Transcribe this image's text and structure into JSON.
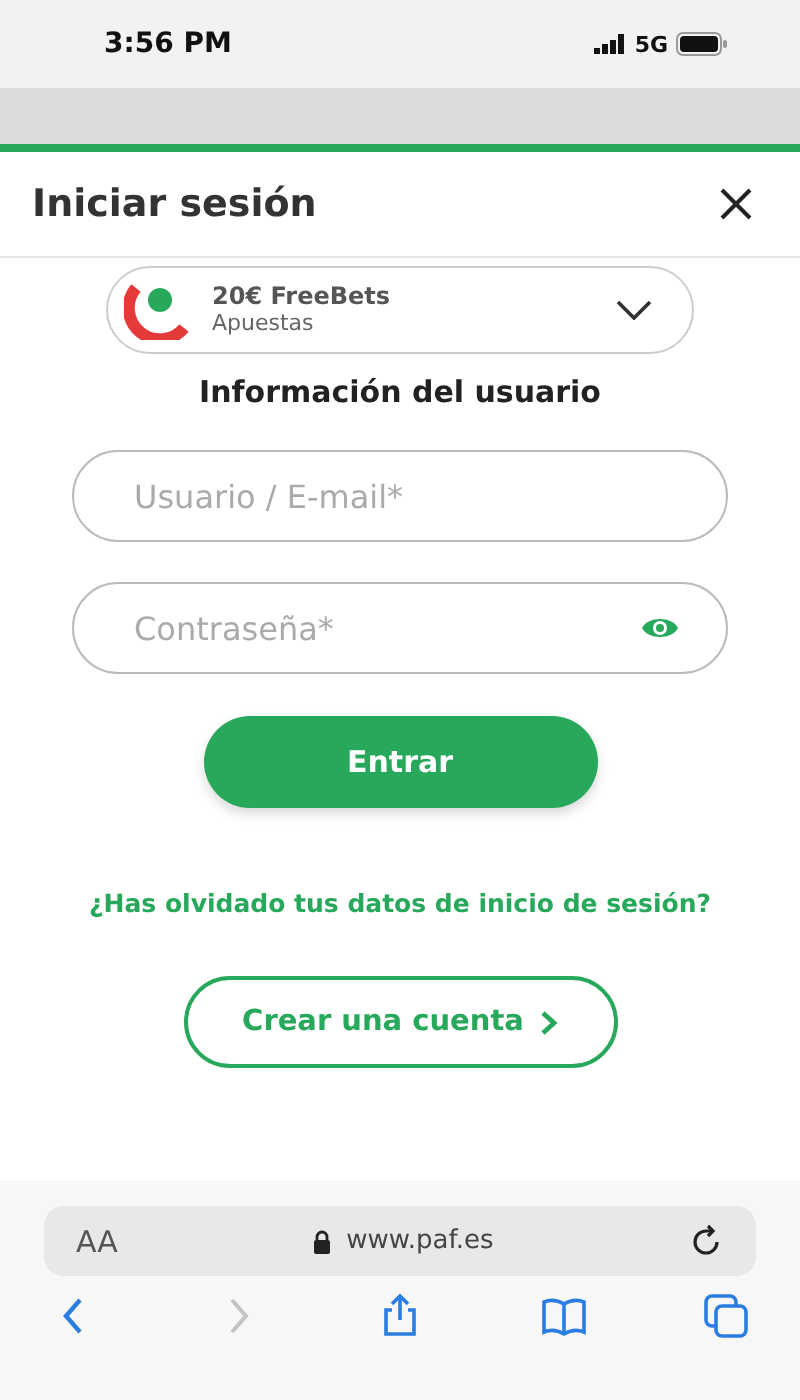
{
  "status_bar": {
    "time": "3:56 PM",
    "network": "5G"
  },
  "header": {
    "title": "Iniciar sesión"
  },
  "promo": {
    "title": "20€ FreeBets",
    "subtitle": "Apuestas"
  },
  "section_title": "Información del usuario",
  "fields": [
    {
      "placeholder": "Usuario / E-mail*",
      "kind": "text"
    },
    {
      "placeholder": "Contraseña*",
      "kind": "password"
    }
  ],
  "submit_button": "Entrar",
  "forgot_link": "¿Has olvidado tus datos de inicio de sesión?",
  "create_account_button": "Crear una cuenta",
  "browser": {
    "text_size": "AA",
    "url": "www.paf.es",
    "nav": [
      {
        "kind": "back",
        "disabled": false
      },
      {
        "kind": "forward",
        "disabled": true
      },
      {
        "kind": "share",
        "disabled": false
      },
      {
        "kind": "bookmarks",
        "disabled": false
      },
      {
        "kind": "tabs",
        "disabled": false
      }
    ]
  }
}
